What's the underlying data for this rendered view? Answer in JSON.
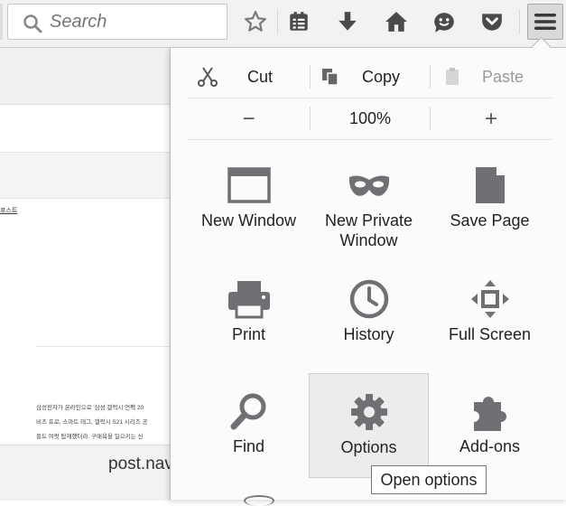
{
  "toolbar": {
    "search": {
      "placeholder": "Search"
    },
    "icons": [
      "bookmark-star-icon",
      "reading-list-icon",
      "download-icon",
      "home-icon",
      "hello-icon",
      "pocket-icon",
      "hamburger-menu-icon"
    ]
  },
  "background_page": {
    "link_text": "포스트",
    "body_lines": [
      "삼성전자가 온라인으로 '삼성 갤럭시 언팩 20",
      "비즈 프로, 스마트 태그, 갤럭시 S21 시리즈 공",
      "들도 여럿 탑재했더라. 구매욕을 일으키는 신"
    ],
    "status_text": "post.nav"
  },
  "menu_panel": {
    "edit": {
      "cut": "Cut",
      "copy": "Copy",
      "paste": "Paste"
    },
    "zoom": {
      "out": "−",
      "level": "100%",
      "in": "+"
    },
    "tiles": [
      {
        "label": "New Window",
        "icon": "new-window-icon"
      },
      {
        "label": "New Private\nWindow",
        "icon": "private-mask-icon"
      },
      {
        "label": "Save Page",
        "icon": "save-page-icon"
      },
      {
        "label": "Print",
        "icon": "printer-icon"
      },
      {
        "label": "History",
        "icon": "history-clock-icon"
      },
      {
        "label": "Full Screen",
        "icon": "fullscreen-icon"
      },
      {
        "label": "Find",
        "icon": "magnifier-icon"
      },
      {
        "label": "Options",
        "icon": "gear-icon"
      },
      {
        "label": "Add-ons",
        "icon": "puzzle-piece-icon"
      }
    ],
    "tooltip": "Open options"
  },
  "colors": {
    "icon_gray": "#6e7074",
    "highlight": "#ececec"
  }
}
